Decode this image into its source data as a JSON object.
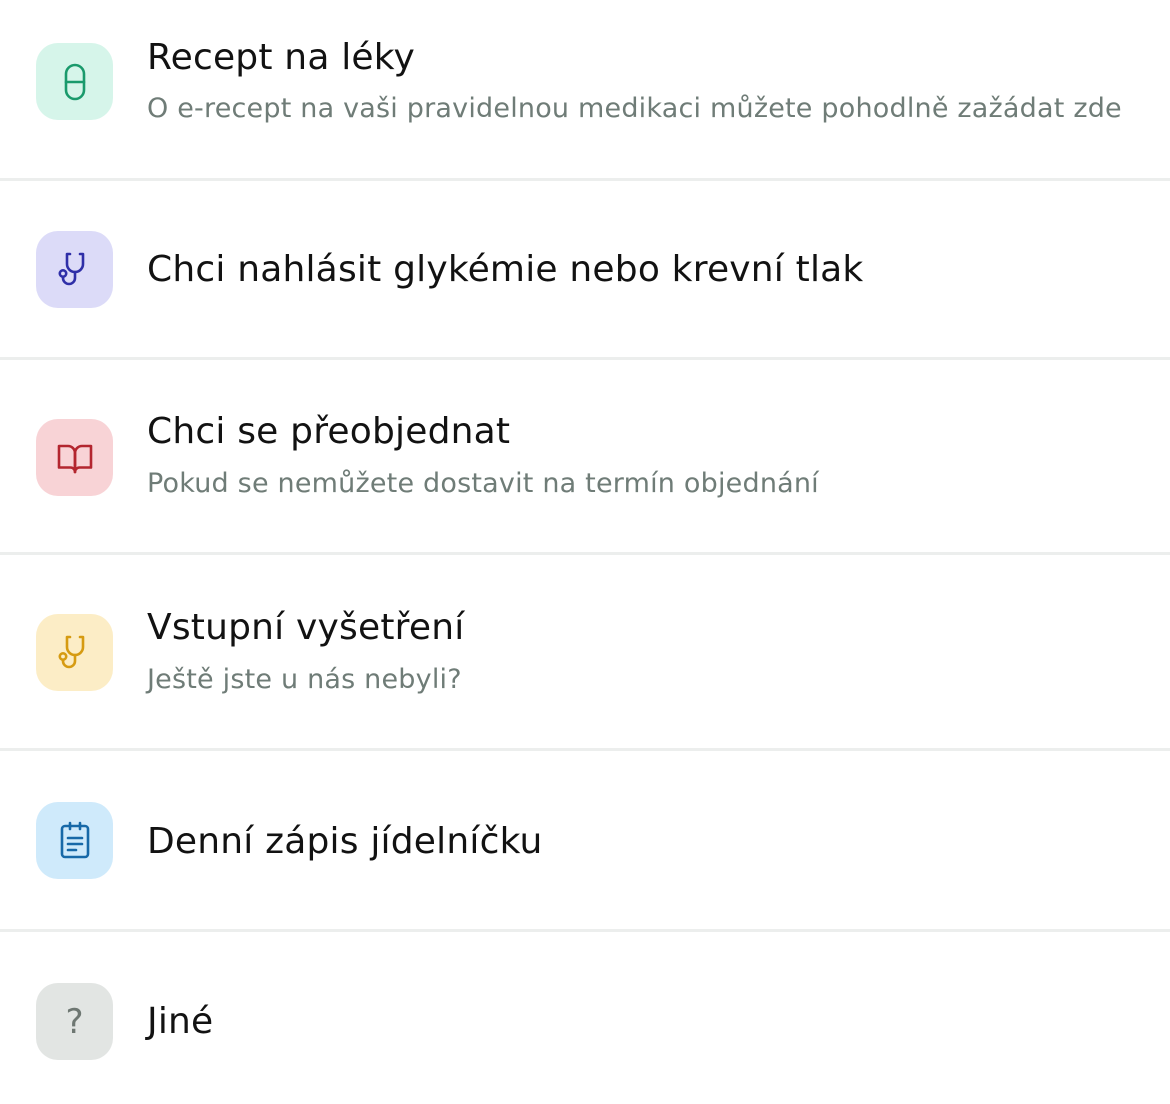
{
  "items": [
    {
      "title": "Recept na léky",
      "subtitle": "O e-recept na vaši pravidelnou medikaci můžete pohodlně zažádat zde",
      "icon": "pill-icon",
      "icon_bg": "#d6f5ea",
      "icon_color": "#1a9a6c"
    },
    {
      "title": "Chci nahlásit glykémie nebo krevní tlak",
      "subtitle": "",
      "icon": "stethoscope-icon",
      "icon_bg": "#dcdbf8",
      "icon_color": "#2f2fa8"
    },
    {
      "title": "Chci se přeobjednat",
      "subtitle": "Pokud se nemůžete dostavit na termín objednání",
      "icon": "book-icon",
      "icon_bg": "#f8d3d6",
      "icon_color": "#b3262f"
    },
    {
      "title": "Vstupní vyšetření",
      "subtitle": "Ještě jste u nás nebyli?",
      "icon": "stethoscope-icon",
      "icon_bg": "#fcedc6",
      "icon_color": "#d69b12"
    },
    {
      "title": "Denní zápis jídelníčku",
      "subtitle": "",
      "icon": "clipboard-icon",
      "icon_bg": "#cfeafb",
      "icon_color": "#1769a8"
    },
    {
      "title": "Jiné",
      "subtitle": "",
      "icon": "question-icon",
      "icon_glyph": "?",
      "icon_bg": "#e2e5e3",
      "icon_color": "#6e7772"
    }
  ]
}
